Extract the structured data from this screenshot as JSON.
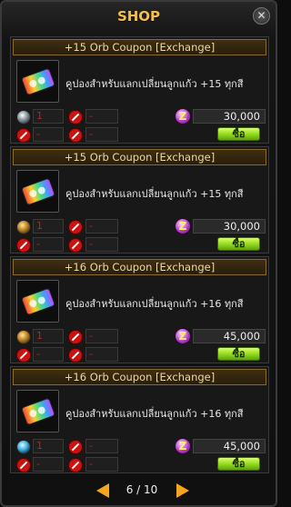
{
  "window": {
    "title": "SHOP",
    "close_icon": "close-icon"
  },
  "items": [
    {
      "title": "+15 Orb Coupon [Exchange]",
      "description": "คูปองสำหรับแลกเปลี่ยนลูกแก้ว +15 ทุกสี",
      "stat_icon": "silver-gem-icon",
      "qty1": "1",
      "qty2": "-",
      "qty3": "-",
      "qty4": "-",
      "currency_icon": "z-coin-icon",
      "price": "30,000",
      "buy_label": "ซื้อ"
    },
    {
      "title": "+15 Orb Coupon [Exchange]",
      "description": "คูปองสำหรับแลกเปลี่ยนลูกแก้ว +15 ทุกสี",
      "stat_icon": "gold-gem-icon",
      "qty1": "1",
      "qty2": "-",
      "qty3": "-",
      "qty4": "-",
      "currency_icon": "z-coin-icon",
      "price": "30,000",
      "buy_label": "ซื้อ"
    },
    {
      "title": "+16 Orb Coupon [Exchange]",
      "description": "คูปองสำหรับแลกเปลี่ยนลูกแก้ว +16 ทุกสี",
      "stat_icon": "gold-gem-icon",
      "qty1": "1",
      "qty2": "-",
      "qty3": "-",
      "qty4": "-",
      "currency_icon": "z-coin-icon",
      "price": "45,000",
      "buy_label": "ซื้อ"
    },
    {
      "title": "+16 Orb Coupon [Exchange]",
      "description": "คูปองสำหรับแลกเปลี่ยนลูกแก้ว +16 ทุกสี",
      "stat_icon": "blue-gem-icon",
      "qty1": "1",
      "qty2": "-",
      "qty3": "-",
      "qty4": "-",
      "currency_icon": "z-coin-icon",
      "price": "45,000",
      "buy_label": "ซื้อ"
    }
  ],
  "pager": {
    "label": "6 / 10"
  },
  "colors": {
    "accent": "#f3c14a",
    "buy": "#8fd81c",
    "no": "#c11111"
  }
}
